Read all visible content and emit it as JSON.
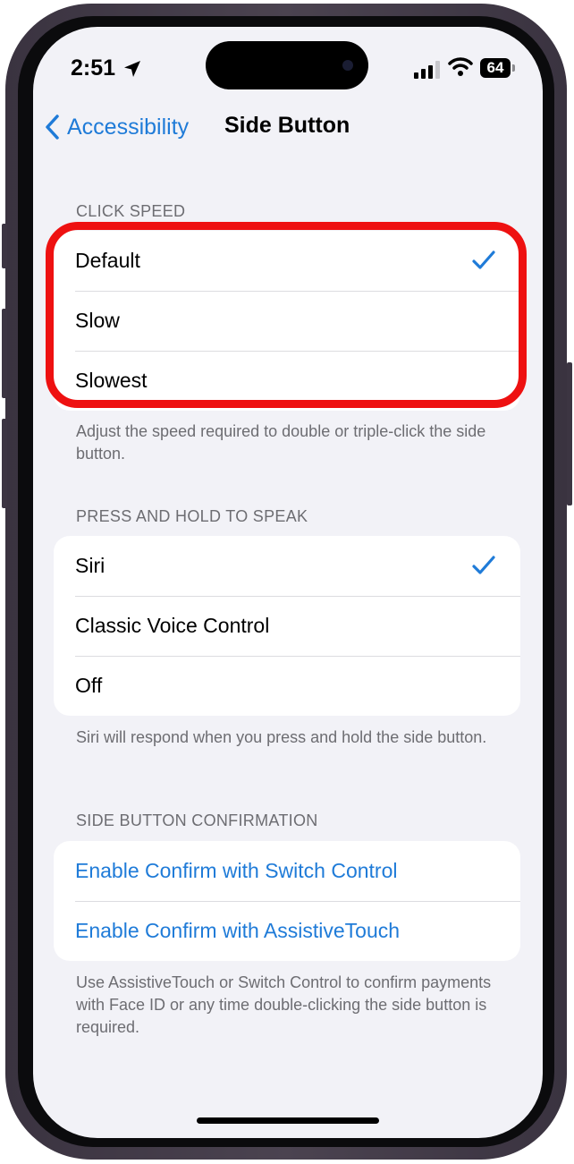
{
  "status_bar": {
    "time": "2:51",
    "battery": "64",
    "icons": [
      "location-arrow-icon",
      "cellular-signal-icon",
      "wifi-icon",
      "battery-icon"
    ]
  },
  "nav": {
    "back_label": "Accessibility",
    "title": "Side Button"
  },
  "click_speed": {
    "header": "CLICK SPEED",
    "options": [
      {
        "label": "Default",
        "selected": true
      },
      {
        "label": "Slow",
        "selected": false
      },
      {
        "label": "Slowest",
        "selected": false
      }
    ],
    "footer": "Adjust the speed required to double or triple-click the side button."
  },
  "press_hold": {
    "header": "PRESS AND HOLD TO SPEAK",
    "options": [
      {
        "label": "Siri",
        "selected": true
      },
      {
        "label": "Classic Voice Control",
        "selected": false
      },
      {
        "label": "Off",
        "selected": false
      }
    ],
    "footer": "Siri will respond when you press and hold the side button."
  },
  "confirmation": {
    "header": "SIDE BUTTON CONFIRMATION",
    "links": [
      {
        "label": "Enable Confirm with Switch Control"
      },
      {
        "label": "Enable Confirm with AssistiveTouch"
      }
    ],
    "footer": "Use AssistiveTouch or Switch Control to confirm payments with Face ID or any time double-clicking the side button is required."
  },
  "colors": {
    "accent": "#1f7bd8",
    "highlight": "#ee1111",
    "background": "#f2f2f7"
  }
}
